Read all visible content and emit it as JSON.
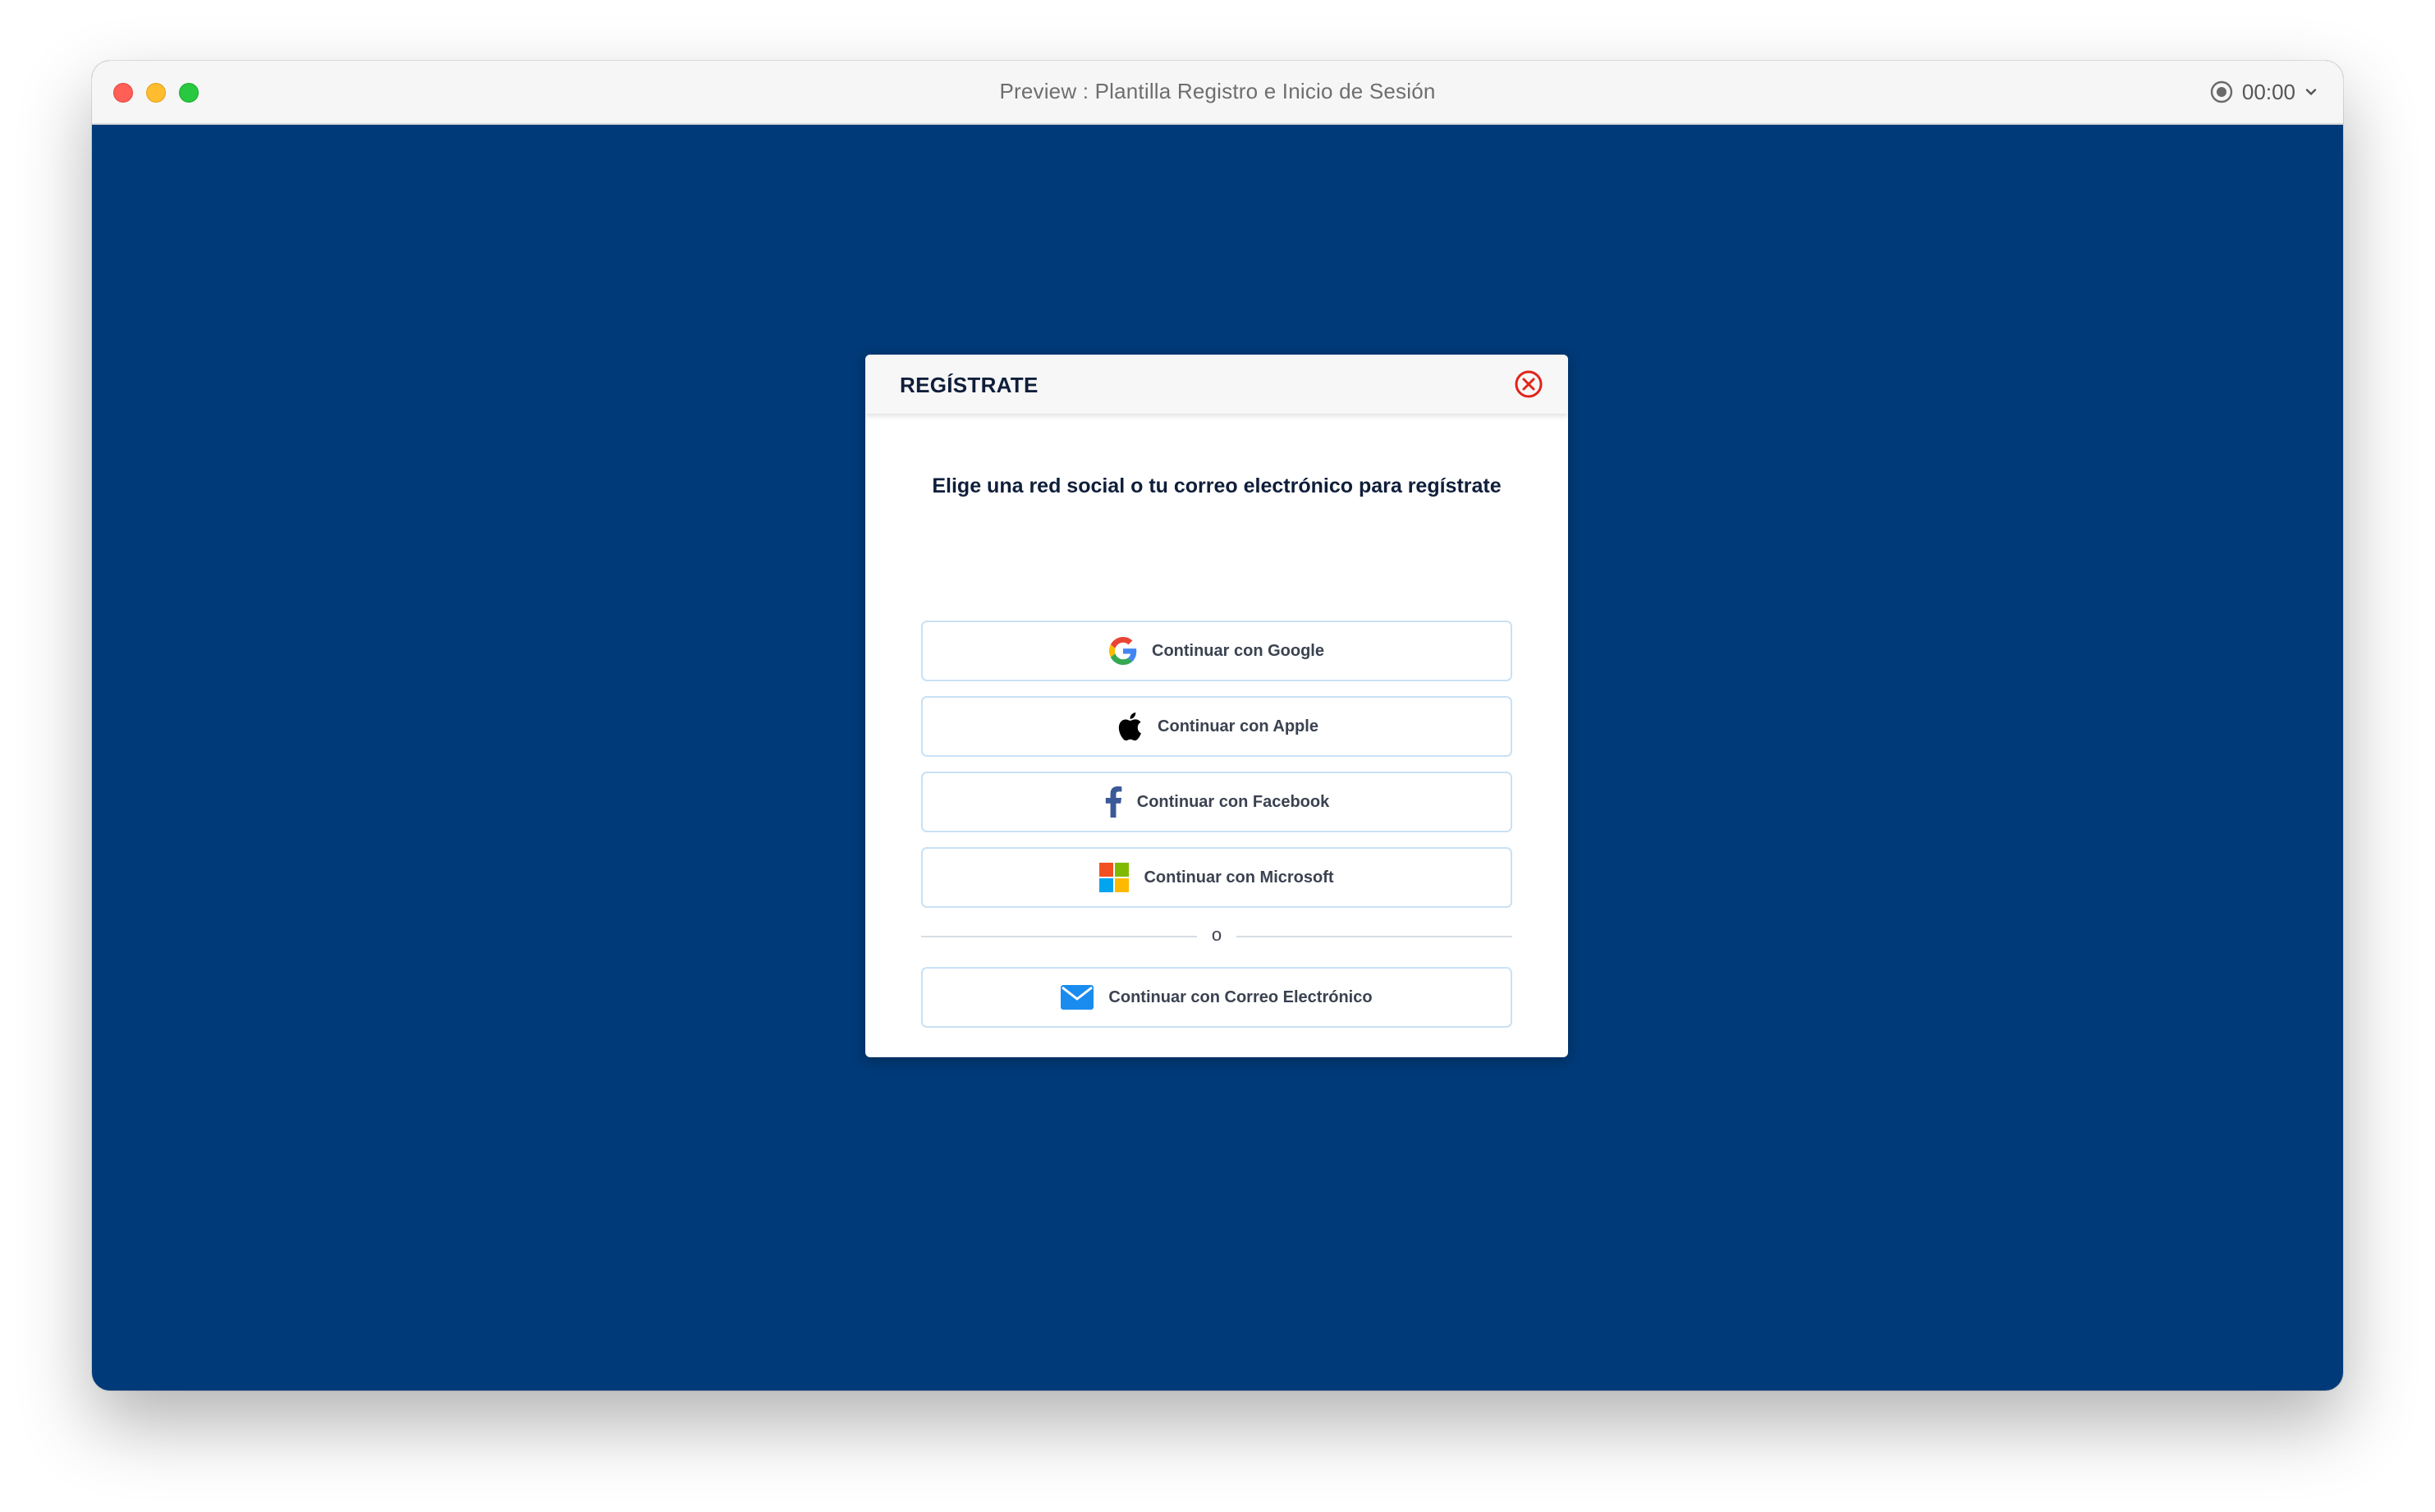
{
  "window": {
    "title": "Preview : Plantilla Registro e Inicio de Sesión",
    "timer": "00:00"
  },
  "modal": {
    "title": "REGÍSTRATE",
    "subtitle": "Elige una red social o tu correo electrónico para regístrate",
    "buttons": {
      "google": "Continuar con Google",
      "apple": "Continuar con Apple",
      "facebook": "Continuar con Facebook",
      "microsoft": "Continuar con Microsoft",
      "email": "Continuar con Correo Electrónico"
    },
    "divider_text": "o"
  },
  "colors": {
    "background": "#013a78",
    "close_icon": "#e2231a",
    "button_border": "#c9e1f5",
    "facebook": "#3b5998",
    "email_icon": "#1a8cf0"
  },
  "icons": {
    "close": "close-circle-icon",
    "google": "google-icon",
    "apple": "apple-icon",
    "facebook": "facebook-icon",
    "microsoft": "microsoft-icon",
    "email": "envelope-icon",
    "record": "record-icon",
    "chevron": "chevron-down-icon"
  }
}
